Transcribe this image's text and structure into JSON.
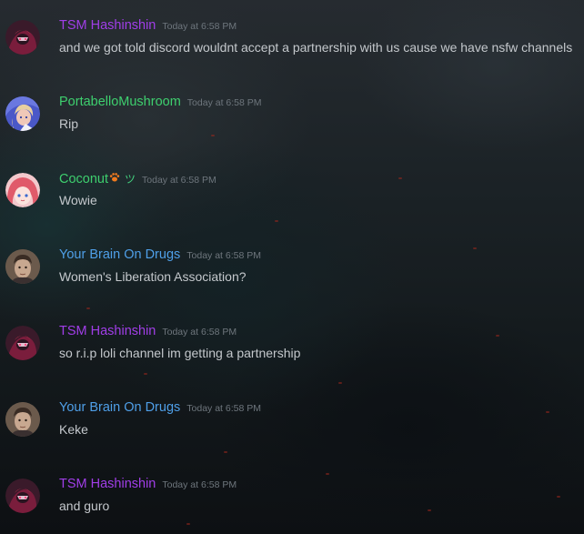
{
  "colors": {
    "tsm": "#a13ee8",
    "portabello": "#3ecf6e",
    "coconut": "#3ecf6e",
    "brain": "#4f9fe8",
    "timestamp": "#6e767d",
    "text": "#c4c8cc"
  },
  "messages": [
    {
      "username": "TSM Hashinshin",
      "timestamp": "Today at 6:58 PM",
      "text": "and we got told discord wouldnt accept a partnership with us cause we have nsfw channels",
      "avatar": "tsm-avatar"
    },
    {
      "username": "PortabelloMushroom",
      "timestamp": "Today at 6:58 PM",
      "text": "Rip",
      "avatar": "portabello-avatar"
    },
    {
      "username": "Coconut",
      "badge_tilde": "ツ",
      "timestamp": "Today at 6:58 PM",
      "text": "Wowie",
      "avatar": "coconut-avatar"
    },
    {
      "username": "Your Brain On Drugs",
      "timestamp": "Today at 6:58 PM",
      "text": "Women's Liberation Association?",
      "avatar": "brain-avatar"
    },
    {
      "username": "TSM Hashinshin",
      "timestamp": "Today at 6:58 PM",
      "text": "so r.i.p loli channel im getting a partnership",
      "avatar": "tsm-avatar"
    },
    {
      "username": "Your Brain On Drugs",
      "timestamp": "Today at 6:58 PM",
      "text": "Keke",
      "avatar": "brain-avatar"
    },
    {
      "username": "TSM Hashinshin",
      "timestamp": "Today at 6:58 PM",
      "text": "and guro",
      "avatar": "tsm-avatar"
    }
  ]
}
